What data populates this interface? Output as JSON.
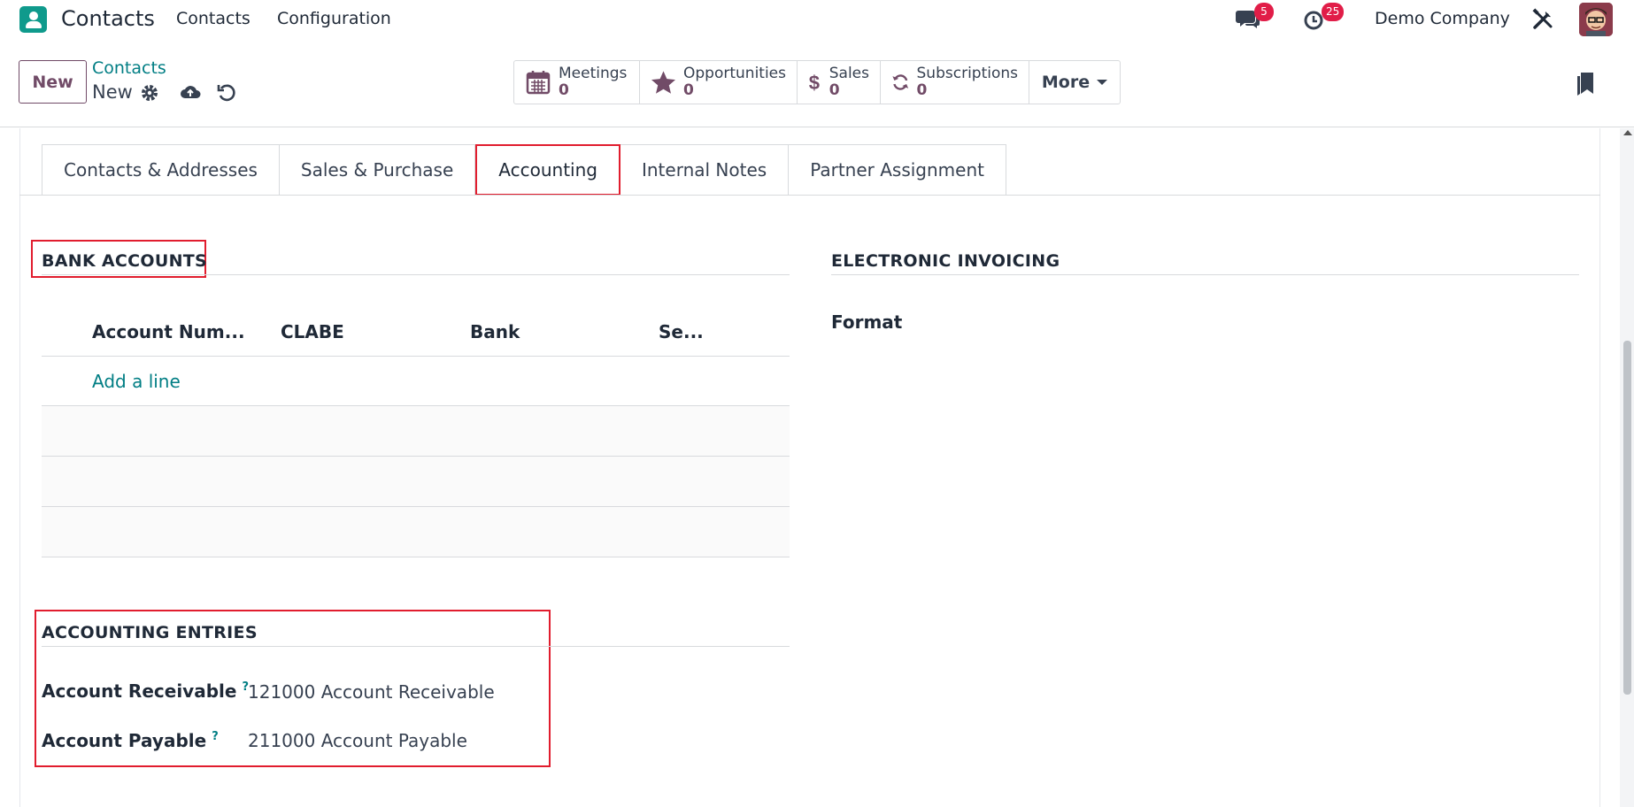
{
  "navbar": {
    "app_name": "Contacts",
    "menu": [
      "Contacts",
      "Configuration"
    ],
    "messages_count": "5",
    "activities_count": "25",
    "company": "Demo Company"
  },
  "control_panel": {
    "new_button": "New",
    "breadcrumb_parent": "Contacts",
    "breadcrumb_current": "New",
    "smart_buttons": [
      {
        "label": "Meetings",
        "value": "0",
        "icon": "calendar-icon"
      },
      {
        "label": "Opportunities",
        "value": "0",
        "icon": "star-icon"
      },
      {
        "label": "Sales",
        "value": "0",
        "icon": "dollar-icon"
      },
      {
        "label": "Subscriptions",
        "value": "0",
        "icon": "refresh-icon"
      }
    ],
    "more_button": "More"
  },
  "tabs": [
    {
      "label": "Contacts & Addresses",
      "active": false
    },
    {
      "label": "Sales & Purchase",
      "active": false
    },
    {
      "label": "Accounting",
      "active": true
    },
    {
      "label": "Internal Notes",
      "active": false
    },
    {
      "label": "Partner Assignment",
      "active": false
    }
  ],
  "bank_accounts": {
    "title": "BANK ACCOUNTS",
    "columns": [
      "Account Num...",
      "CLABE",
      "Bank",
      "Se..."
    ],
    "add_line": "Add a line"
  },
  "electronic_invoicing": {
    "title": "ELECTRONIC INVOICING",
    "format_label": "Format"
  },
  "accounting_entries": {
    "title": "ACCOUNTING ENTRIES",
    "receivable_label": "Account Receivable",
    "receivable_value": "121000 Account Receivable",
    "payable_label": "Account Payable",
    "payable_value": "211000 Account Payable",
    "help_mark": "?"
  },
  "colors": {
    "brand_purple": "#714b67",
    "link_teal": "#017e84",
    "highlight_red": "#e11d2e",
    "badge_red": "#e11d48"
  }
}
